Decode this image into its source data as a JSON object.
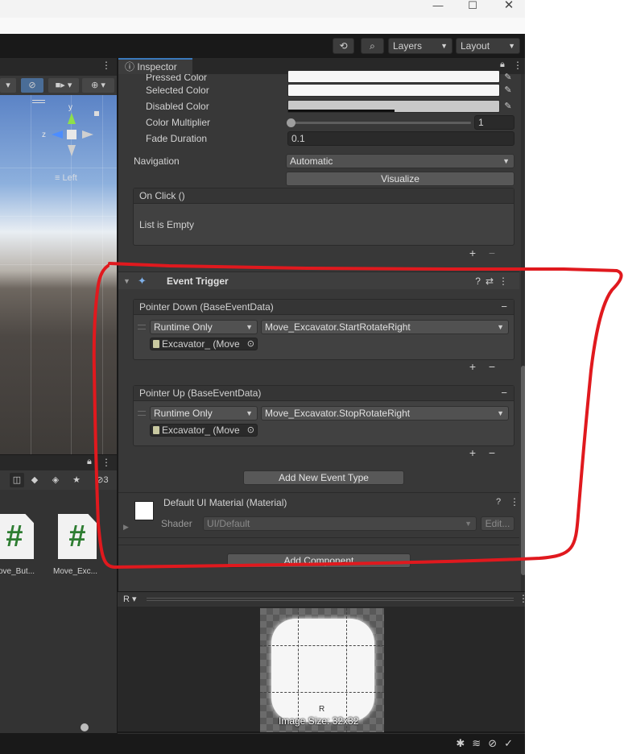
{
  "window": {
    "minimize_glyph": "—",
    "maximize_glyph": "☐",
    "close_glyph": "✕"
  },
  "toolbar": {
    "layers_label": "Layers",
    "layout_label": "Layout",
    "history_icon": "history-icon",
    "search_icon": "search-icon"
  },
  "project": {
    "badge_count": "3",
    "items": [
      {
        "label": "ove_But...",
        "icon": "csharp-script-icon"
      },
      {
        "label": "Move_Exc...",
        "icon": "csharp-script-icon"
      }
    ]
  },
  "scene": {
    "axis_y": "y",
    "axis_z": "z",
    "view_label": "≡ Left"
  },
  "inspector": {
    "tab_label": "Inspector",
    "pressed_color_label": "Pressed Color",
    "selected_color_label": "Selected Color",
    "disabled_color_label": "Disabled Color",
    "color_multiplier_label": "Color Multiplier",
    "color_multiplier_value": "1",
    "color_multiplier_level": 0.0,
    "fade_duration_label": "Fade Duration",
    "fade_duration_value": "0.1",
    "navigation_label": "Navigation",
    "navigation_value": "Automatic",
    "visualize_label": "Visualize",
    "on_click_label": "On Click ()",
    "list_empty_label": "List is Empty",
    "event_trigger": {
      "title": "Event Trigger",
      "entries": [
        {
          "header": "Pointer Down (BaseEventData)",
          "mode": "Runtime Only",
          "function": "Move_Excavator.StartRotateRight",
          "object": "Excavator_ (Move"
        },
        {
          "header": "Pointer Up (BaseEventData)",
          "mode": "Runtime Only",
          "function": "Move_Excavator.StopRotateRight",
          "object": "Excavator_ (Move"
        }
      ],
      "add_event_label": "Add New Event Type"
    },
    "material": {
      "title": "Default UI Material (Material)",
      "shader_label": "Shader",
      "shader_value": "UI/Default",
      "edit_label": "Edit..."
    },
    "add_component_label": "Add Component"
  },
  "preview": {
    "label": "R",
    "sprite_letter": "R",
    "image_size": "Image Size: 32x32"
  },
  "colors": {
    "annotation_red": "#e0191e",
    "accent_blue": "#3a79bb",
    "editor_bg": "#383838"
  },
  "plus": "+",
  "minus": "−"
}
